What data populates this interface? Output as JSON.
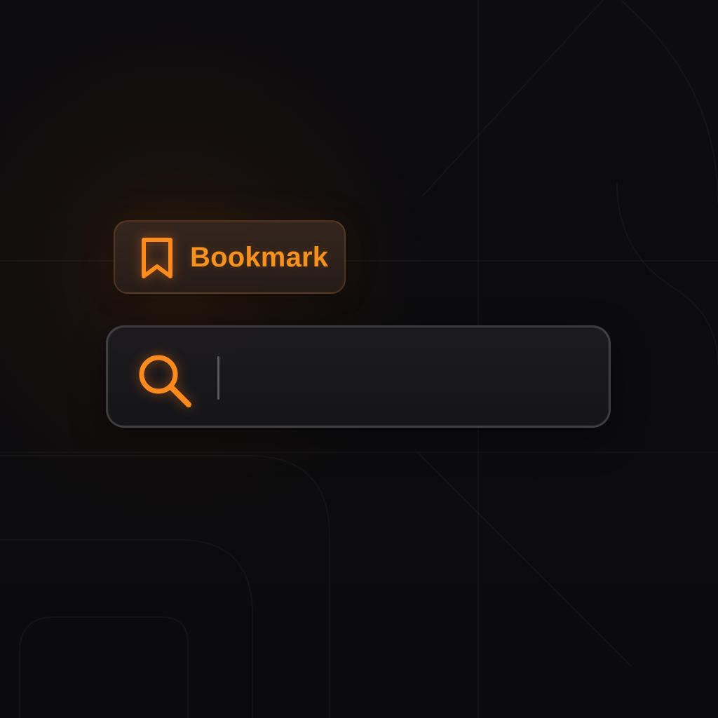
{
  "bookmark_button": {
    "label": "Bookmark",
    "icon": "bookmark-icon",
    "accent_color": "#F5921F"
  },
  "search_bar": {
    "icon": "search-icon",
    "value": "",
    "placeholder": "",
    "accent_color": "#FF8B1F"
  },
  "theme": {
    "background": "#0C0B0D",
    "surface": "#1D1C1F",
    "border": "#A2A2A8"
  }
}
